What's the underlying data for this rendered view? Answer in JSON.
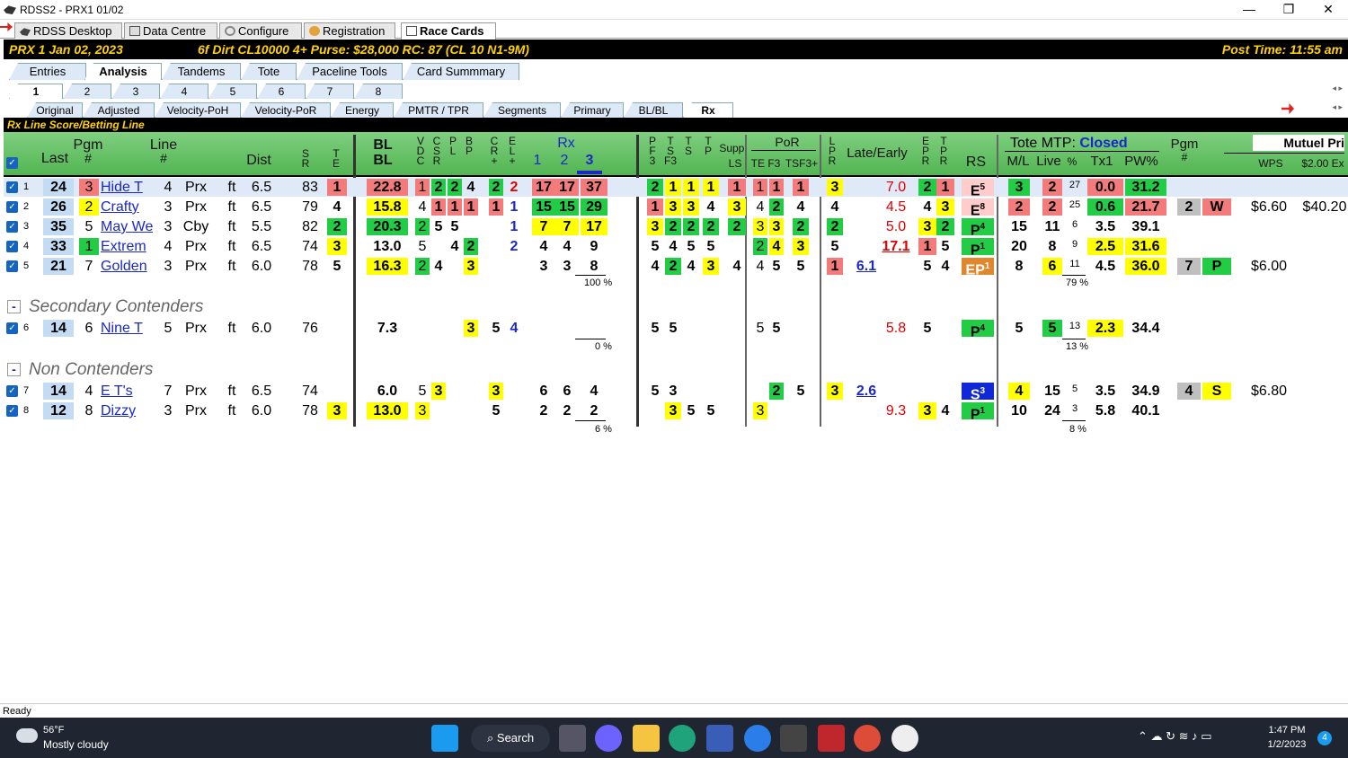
{
  "window": {
    "title": "RDSS2 - PRX1  01/02",
    "min": "—",
    "max": "❐",
    "close": "✕"
  },
  "tabs": [
    "RDSS Desktop",
    "Data Centre",
    "Configure",
    "Registration",
    "Race Cards"
  ],
  "race": {
    "info": "PRX  1   Jan 02, 2023",
    "cond": "6f  Dirt   CL10000  4+   Purse: $28,000   RC: 87  (CL 10 N1-9M)",
    "post": "Post Time: 11:55 am"
  },
  "subtabs1": [
    "Entries",
    "Analysis",
    "Tandems",
    "Tote",
    "Paceline Tools",
    "Card Summmary"
  ],
  "subtabs2": [
    "1",
    "2",
    "3",
    "4",
    "5",
    "6",
    "7",
    "8"
  ],
  "subtabs3": [
    "Original",
    "Adjusted",
    "Velocity-PoH",
    "Velocity-PoR",
    "Energy",
    "PMTR / TPR",
    "Segments",
    "Primary",
    "BL/BL",
    "Rx"
  ],
  "section_title": "Rx Line Score/Betting Line",
  "headers": {
    "last": "Last",
    "pgm": "Pgm",
    "pgm_hash": "#",
    "line": "Line",
    "line_hash": "#",
    "dist": "Dist",
    "sr": "S\nR",
    "te": "T\nE",
    "blbl": "BL\nBL",
    "vdc": "V\nD\nC",
    "csr": "C\nS\nR",
    "pl": "P\nL",
    "bp": "B\nP",
    "crplus": "C\nR\n+",
    "elplus": "E\nL\n+",
    "rx": "Rx",
    "rx1": "1",
    "rx2": "2",
    "rx3": "3",
    "pf3": "P\nF\n3",
    "tsf3": "T\nS\nF3",
    "ts": "T\nS",
    "tp": "T\nP",
    "supp": "Supp.",
    "ls": "LS",
    "por": "PoR",
    "tef3": "TE F3",
    "tsf3plus": "TSF3+",
    "lpr": "L\nP\nR",
    "late": "Late/Early",
    "epr": "E\nP\nR",
    "tpr": "T\nP\nR",
    "rs": "RS",
    "tote": "Tote MTP:",
    "closed": "Closed",
    "ml": "M/L",
    "live": "Live",
    "pctsym": "%",
    "tx1": "Tx1",
    "pw": "PW%",
    "pgm2": "Pgm",
    "pgm2hash": "#",
    "mutuel": "Mutuel Pri",
    "wps": "WPS",
    "ex": "$2.00 Ex"
  },
  "rows": [
    {
      "n": "1",
      "last": "24",
      "pgm": "3",
      "name": "Hide T",
      "line": "4",
      "trk": "Prx",
      "ft": "ft",
      "dist": "6.5",
      "sr": "83",
      "te": "1",
      "bl": "22.8",
      "vdc": "1",
      "csr": "2",
      "pl": "2",
      "bp": "4",
      "cr": "2",
      "el": "2",
      "rx1": "17",
      "rx2": "17",
      "rx3": "37",
      "pf3": "2",
      "tsf3": "1",
      "ts": "1",
      "tp": "1",
      "ls": "1",
      "tef3a": "1",
      "tef3b": "1",
      "tsf3p": "1",
      "lpr": "3",
      "late": "7.0",
      "epr": "2",
      "tpr": "1",
      "rs": "E",
      "rsn": "5",
      "ml": "3",
      "live": "2",
      "pct": "27",
      "tx1": "0.0",
      "pw": "31.2"
    },
    {
      "n": "2",
      "last": "26",
      "pgm": "2",
      "name": "Crafty",
      "line": "3",
      "trk": "Prx",
      "ft": "ft",
      "dist": "6.5",
      "sr": "79",
      "te": "4",
      "bl": "15.8",
      "vdc": "4",
      "csr": "1",
      "pl": "1",
      "bp": "1",
      "cr": "1",
      "el": "1",
      "rx1": "15",
      "rx2": "15",
      "rx3": "29",
      "pf3": "1",
      "tsf3": "3",
      "ts": "3",
      "tp": "4",
      "ls": "3",
      "tef3a": "4",
      "tef3b": "2",
      "tsf3p": "4",
      "lpr": "4",
      "late": "4.5",
      "epr": "4",
      "tpr": "3",
      "rs": "E",
      "rsn": "8",
      "ml": "2",
      "live": "2",
      "pct": "25",
      "tx1": "0.6",
      "pw": "21.7",
      "pgm2": "2",
      "wps": "W",
      "m1": "$6.60",
      "m2": "$40.20"
    },
    {
      "n": "3",
      "last": "35",
      "pgm": "5",
      "name": "May We",
      "line": "3",
      "trk": "Cby",
      "ft": "ft",
      "dist": "5.5",
      "sr": "82",
      "te": "2",
      "bl": "20.3",
      "vdc": "2",
      "csr": "5",
      "pl": "5",
      "el": "1",
      "rx1": "7",
      "rx2": "7",
      "rx3": "17",
      "pf3": "3",
      "tsf3": "2",
      "ts": "2",
      "tp": "2",
      "ls": "2",
      "tef3a": "3",
      "tef3b": "3",
      "tsf3p": "2",
      "lpr": "2",
      "late": "5.0",
      "epr": "3",
      "tpr": "2",
      "rs": "P",
      "rsn": "4",
      "ml": "15",
      "live": "11",
      "pct": "6",
      "tx1": "3.5",
      "pw": "39.1"
    },
    {
      "n": "4",
      "last": "33",
      "pgm": "1",
      "name": "Extrem",
      "line": "4",
      "trk": "Prx",
      "ft": "ft",
      "dist": "6.5",
      "sr": "74",
      "te": "3",
      "bl": "13.0",
      "vdc": "5",
      "pl": "4",
      "bp": "2",
      "el": "2",
      "rx1": "4",
      "rx2": "4",
      "rx3": "9",
      "pf3": "5",
      "tsf3": "4",
      "ts": "5",
      "tp": "5",
      "tef3a": "2",
      "tef3b": "4",
      "tsf3p": "3",
      "lpr": "5",
      "late": "17.1",
      "epr": "1",
      "tpr": "5",
      "rs": "P",
      "rsn": "1",
      "ml": "20",
      "live": "8",
      "pct": "9",
      "tx1": "2.5",
      "pw": "31.6"
    },
    {
      "n": "5",
      "last": "21",
      "pgm": "7",
      "name": "Golden",
      "line": "3",
      "trk": "Prx",
      "ft": "ft",
      "dist": "6.0",
      "sr": "78",
      "te": "5",
      "bl": "16.3",
      "vdc": "2",
      "csr": "4",
      "bp": "3",
      "rx1": "3",
      "rx2": "3",
      "rx3": "8",
      "pf3": "4",
      "tsf3": "2",
      "ts": "4",
      "tp": "3",
      "ls": "4",
      "tef3a": "4",
      "tef3b": "5",
      "tsf3p": "5",
      "lpr": "1",
      "early": "6.1",
      "epr": "5",
      "tpr": "4",
      "rs": "EP",
      "rsn": "1",
      "ml": "8",
      "live": "6",
      "pct": "11",
      "tx1": "4.5",
      "pw": "36.0",
      "pgm2": "7",
      "wps": "P",
      "m1": "$6.00"
    },
    {
      "n": "6",
      "last": "14",
      "pgm": "6",
      "name": "Nine T",
      "line": "5",
      "trk": "Prx",
      "ft": "ft",
      "dist": "6.0",
      "sr": "76",
      "bl": "7.3",
      "bp": "3",
      "cr": "5",
      "el": "4",
      "pf3": "5",
      "tsf3": "5",
      "tef3a": "5",
      "tef3b": "5",
      "late": "5.8",
      "epr": "5",
      "rs": "P",
      "rsn": "4",
      "ml": "5",
      "live": "5",
      "pct": "13",
      "tx1": "2.3",
      "pw": "34.4"
    },
    {
      "n": "7",
      "last": "14",
      "pgm": "4",
      "name": "E T's",
      "line": "7",
      "trk": "Prx",
      "ft": "ft",
      "dist": "6.5",
      "sr": "74",
      "bl": "6.0",
      "vdc": "5",
      "csr": "3",
      "cr": "3",
      "rx1": "6",
      "rx2": "6",
      "rx3": "4",
      "pf3": "5",
      "tsf3": "3",
      "tef3b": "2",
      "tsf3p": "5",
      "lpr": "3",
      "early": "2.6",
      "rs": "S",
      "rsn": "3",
      "ml": "4",
      "live": "15",
      "pct": "5",
      "tx1": "3.5",
      "pw": "34.9",
      "pgm2": "4",
      "wps": "S",
      "m1": "$6.80"
    },
    {
      "n": "8",
      "last": "12",
      "pgm": "8",
      "name": "Dizzy",
      "line": "3",
      "trk": "Prx",
      "ft": "ft",
      "dist": "6.0",
      "sr": "78",
      "te": "3",
      "bl": "13.0",
      "vdc": "3",
      "cr": "5",
      "rx1": "2",
      "rx2": "2",
      "rx3": "2",
      "tsf3": "3",
      "ts": "5",
      "tp": "5",
      "tef3a": "3",
      "late": "9.3",
      "epr": "3",
      "tpr": "4",
      "rs": "P",
      "rsn": "1",
      "ml": "10",
      "live": "24",
      "pct": "3",
      "tx1": "5.8",
      "pw": "40.1"
    }
  ],
  "groups": {
    "secondary": "Secondary Contenders",
    "non": "Non Contenders",
    "minus": "-"
  },
  "percents": {
    "g1": "100 %",
    "g2": "0 %",
    "g3": "6 %",
    "t1": "79 %",
    "t2": "13 %",
    "t3": "8 %"
  },
  "status": "Ready",
  "taskbar": {
    "temp": "56°F",
    "weather": "Mostly cloudy",
    "search": "Search",
    "time": "1:47 PM",
    "date": "1/2/2023",
    "badge": "4"
  }
}
